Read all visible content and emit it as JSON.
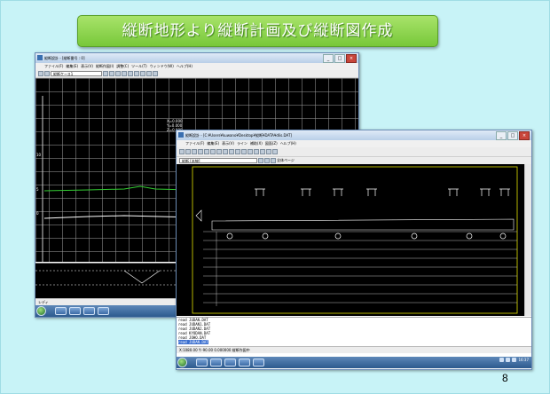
{
  "slide": {
    "title": "縦断地形より縦断計画及び縦断図作成",
    "page_number": "8"
  },
  "colors": {
    "background": "#c8f3f7",
    "title_green": "#8fd44f",
    "canvas": "#000000",
    "ground_line": "#33cc33",
    "frame_yellow": "#e0e000"
  },
  "left_window": {
    "title": "縦断設計 - [縦断番号 : 0]",
    "menu": [
      "ファイル(F)",
      "編集(E)",
      "表示(V)",
      "縦断作図(I)",
      "調整(C)",
      "ツール(T)",
      "ウィンドウ(W)",
      "ヘルプ(H)"
    ],
    "view_select": "縦断ケース1",
    "y_axis_labels": [
      "10",
      "5",
      "0"
    ],
    "readout_labels": [
      "X=0.000",
      "Y=0.000",
      "Z=0.000"
    ],
    "status": "レディ",
    "taskbar_icons": [
      "start-orb-icon",
      "explorer-icon",
      "media-icon",
      "app-icon",
      "app2-icon"
    ]
  },
  "right_window": {
    "title": "縦断設計 - [C:¥Users¥kuwano¥Desktop¥縦断¥DATA¥dlis.DAT]",
    "menu": [
      "ファイル(F)",
      "編集(E)",
      "表示(V)",
      "ライン",
      "補助(X)",
      "図面(Z)",
      "ヘルプ(H)"
    ],
    "view_select": "縦断 [本線]",
    "view_select_2": "全体ページ",
    "log_lines": [
      "read JUDAN.DAT",
      "read JUDAN1.DAT",
      "read JUDAN2.DAT",
      "read KYODAN.DAT",
      "read JOHO.DAT",
      "read JUDAN.DAT"
    ],
    "status_text": "X:1080.00  Y:-90.00  0.000000  縦断作図中",
    "clock": "16:37",
    "taskbar_icons": [
      "start-orb-icon",
      "explorer-icon",
      "media-icon",
      "app-icon",
      "folder-icon",
      "paint-icon"
    ]
  }
}
